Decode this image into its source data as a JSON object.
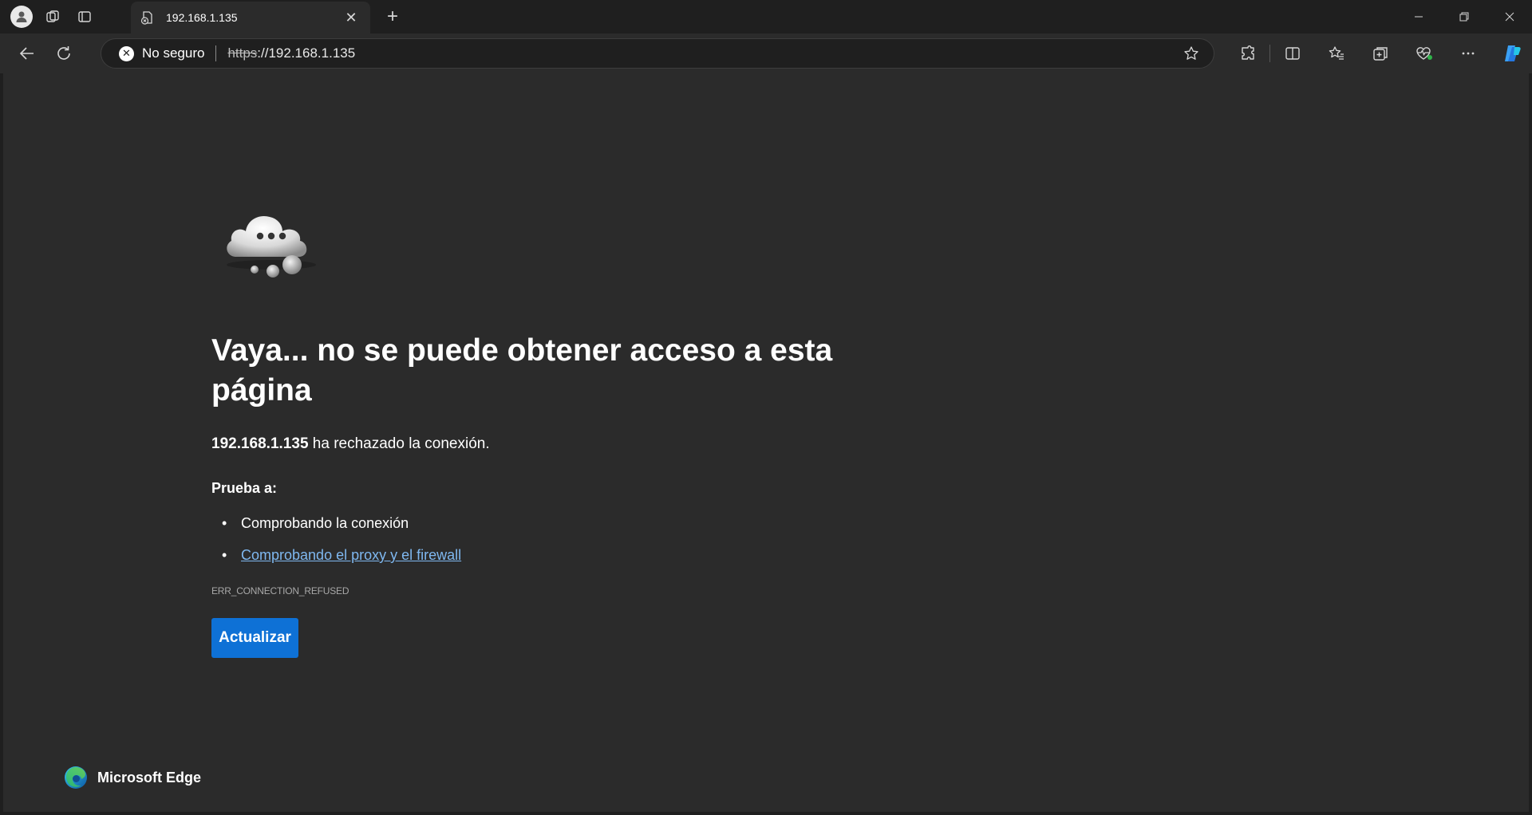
{
  "tab": {
    "title": "192.168.1.135",
    "close_icon": "close-icon"
  },
  "toolbar": {
    "security_label": "No seguro",
    "url_protocol": "https",
    "url_rest": "://192.168.1.135"
  },
  "error_page": {
    "heading": "Vaya... no se puede obtener acceso a esta página",
    "host": "192.168.1.135",
    "reason_rest": " ha rechazado la conexión.",
    "try_label": "Prueba a:",
    "suggestions": [
      {
        "text": "Comprobando la conexión",
        "link": false
      },
      {
        "text": "Comprobando el proxy y el firewall",
        "link": true
      }
    ],
    "error_code": "ERR_CONNECTION_REFUSED",
    "refresh_label": "Actualizar"
  },
  "brand": {
    "name": "Microsoft Edge"
  },
  "colors": {
    "accent": "#0e71d6",
    "link": "#7fb8f0",
    "page_bg": "#2b2b2b",
    "frame_bg": "#1f1f1f"
  }
}
